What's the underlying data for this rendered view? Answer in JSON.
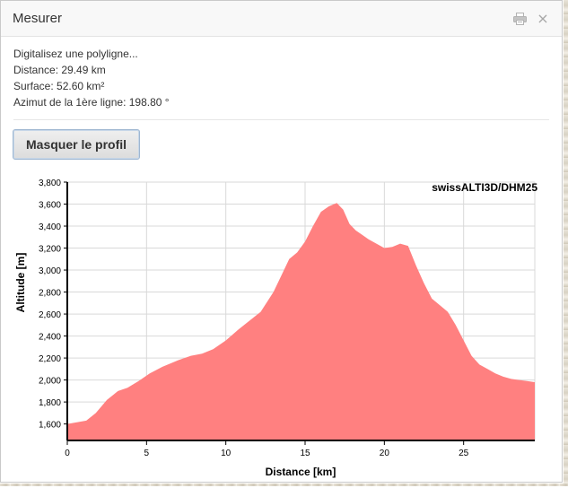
{
  "dialog": {
    "title": "Mesurer",
    "print_icon": "print-icon",
    "close_icon": "close-icon",
    "close_glyph": "×"
  },
  "info": {
    "instruction": "Digitalisez une polyligne...",
    "distance": "Distance: 29.49 km",
    "surface": "Surface: 52.60 km²",
    "azimuth": "Azimut de la 1ère ligne: 198.80 °"
  },
  "profile_button": {
    "label": "Masquer le profil"
  },
  "colors": {
    "area_fill": "#ff8080",
    "grid": "#d9d9d9",
    "axis": "#000000",
    "button_border": "#9fb7d1"
  },
  "chart_data": {
    "type": "area",
    "title": "swissALTI3D/DHM25",
    "xlabel": "Distance [km]",
    "ylabel": "Altitude [m]",
    "xlim": [
      0,
      29.49
    ],
    "ylim": [
      1450,
      3800
    ],
    "x_ticks": [
      0,
      5,
      10,
      15,
      20,
      25
    ],
    "x_tick_labels": [
      "0",
      "5",
      "10",
      "15",
      "20",
      "25"
    ],
    "y_ticks": [
      1600,
      1800,
      2000,
      2200,
      2400,
      2600,
      2800,
      3000,
      3200,
      3400,
      3600,
      3800
    ],
    "y_tick_labels": [
      "1,600",
      "1,800",
      "2,000",
      "2,200",
      "2,400",
      "2,600",
      "2,800",
      "3,000",
      "3,200",
      "3,400",
      "3,600",
      "3,800"
    ],
    "grid": true,
    "legend": "none",
    "series": [
      {
        "x": [
          0,
          1.2,
          1.8,
          2.5,
          3.2,
          3.8,
          4.5,
          5.2,
          6.0,
          7.0,
          7.8,
          8.5,
          9.2,
          10.0,
          10.8,
          11.5,
          12.2,
          13.0,
          13.5,
          14.0,
          14.5,
          15.0,
          15.5,
          16.0,
          16.5,
          17.0,
          17.4,
          17.8,
          18.2,
          18.6,
          19.0,
          19.5,
          20.0,
          20.5,
          21.0,
          21.5,
          22.0,
          22.5,
          23.0,
          23.5,
          24.0,
          24.5,
          25.0,
          25.5,
          26.0,
          26.5,
          27.0,
          27.5,
          28.0,
          28.5,
          29.0,
          29.49
        ],
        "y": [
          1600,
          1630,
          1700,
          1820,
          1900,
          1930,
          1990,
          2060,
          2120,
          2180,
          2220,
          2240,
          2280,
          2360,
          2460,
          2540,
          2620,
          2800,
          2950,
          3100,
          3160,
          3260,
          3400,
          3530,
          3580,
          3610,
          3550,
          3420,
          3360,
          3320,
          3280,
          3240,
          3200,
          3210,
          3240,
          3220,
          3040,
          2880,
          2740,
          2680,
          2620,
          2500,
          2360,
          2220,
          2140,
          2100,
          2060,
          2030,
          2010,
          2000,
          1990,
          1980
        ]
      }
    ]
  }
}
